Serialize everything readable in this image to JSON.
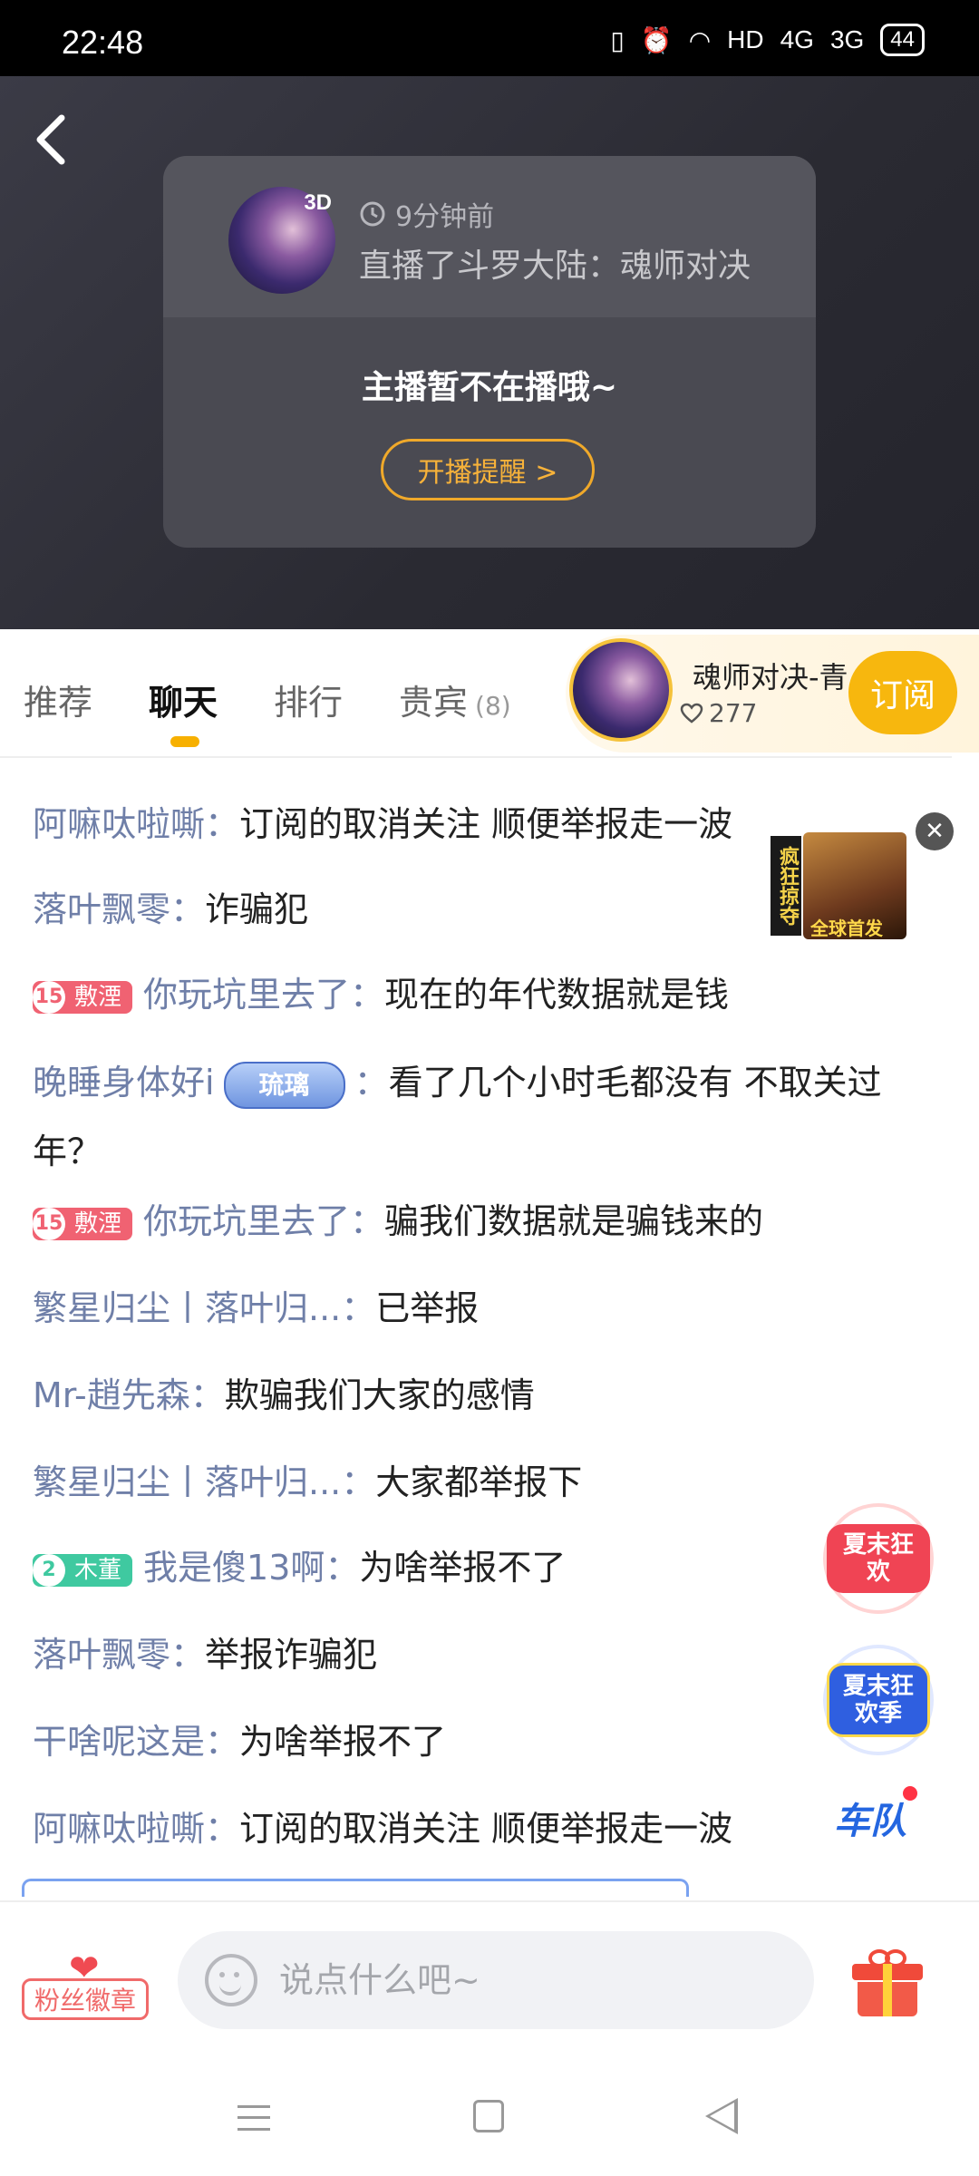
{
  "status_bar": {
    "time": "22:48",
    "network_label": "HD",
    "signal_1": "4G",
    "signal_2": "3G",
    "battery": "44"
  },
  "live_card": {
    "time_ago": "9分钟前",
    "last_stream": "直播了斗罗大陆：魂师对决",
    "avatar_tag": "3D",
    "offline_message": "主播暂不在播哦~",
    "remind_button": "开播提醒 >"
  },
  "tabs": [
    {
      "label": "推荐"
    },
    {
      "label": "聊天"
    },
    {
      "label": "排行"
    },
    {
      "label": "贵宾",
      "count": "(8)"
    }
  ],
  "channel": {
    "name": "魂师对决-青",
    "likes": "277",
    "subscribe_label": "订阅"
  },
  "float_ad": {
    "title": "疯狂掠夺",
    "label": "全球首发"
  },
  "chat": [
    {
      "nick": "阿嘛呔啦嘶",
      "sep": "：",
      "text": "订阅的取消关注 顺便举报走一波"
    },
    {
      "nick": "落叶飘零",
      "sep": "：",
      "text": "诈骗犯"
    },
    {
      "badge_level": "15",
      "badge_text": "敷湮",
      "nick": "你玩坑里去了",
      "sep": "：",
      "text": "现在的年代数据就是钱"
    },
    {
      "nick": "晚睡身体好i",
      "medal": "琉璃",
      "sep": "：",
      "text": "看了几个小时毛都没有 不取关过年？"
    },
    {
      "badge_level": "15",
      "badge_text": "敷湮",
      "nick": "你玩坑里去了",
      "sep": "：",
      "text": "骗我们数据就是骗钱来的"
    },
    {
      "nick": "繁星归尘丨落叶归...",
      "sep": "：",
      "text": "已举报"
    },
    {
      "nick": "Mr-趙先森",
      "sep": "：",
      "text": "欺骗我们大家的感情"
    },
    {
      "nick": "繁星归尘丨落叶归...",
      "sep": "：",
      "text": "大家都举报下"
    },
    {
      "badge_level": "2",
      "badge_text": "木董",
      "nick": "我是傻13啊",
      "sep": "：",
      "text": "为啥举报不了"
    },
    {
      "nick": "落叶飘零",
      "sep": "：",
      "text": "举报诈骗犯"
    },
    {
      "nick": "干啥呢这是",
      "sep": "：",
      "text": "为啥举报不了"
    },
    {
      "nick": "阿嘛呔啦嘶",
      "sep": "：",
      "text": "订阅的取消关注 顺便举报走一波"
    }
  ],
  "promos": {
    "promo1": "夏末狂欢",
    "promo2": "夏末狂欢季",
    "team": "车队"
  },
  "bottom": {
    "fans_badge": "粉丝徽章",
    "input_placeholder": "说点什么吧~"
  },
  "colors": {
    "accent": "#f7b70e",
    "nick": "#6f7fa8",
    "badge_red": "#f06272",
    "badge_green": "#3fc9a0"
  }
}
